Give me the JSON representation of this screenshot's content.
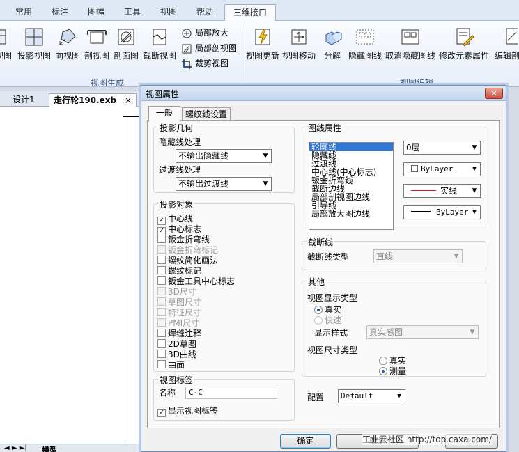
{
  "menu": {
    "tabs": [
      "常用",
      "标注",
      "图幅",
      "工具",
      "视图",
      "帮助",
      "三维接口"
    ],
    "active": "三维接口"
  },
  "ribbon": {
    "group1": {
      "buttons": [
        "视图",
        "投影视图",
        "向视图",
        "剖视图",
        "剖面图",
        "截断视图"
      ],
      "small": [
        "局部放大",
        "局部剖视图",
        "裁剪视图"
      ],
      "name": "视图生成"
    },
    "group2": {
      "buttons": [
        "视图更新",
        "视图移动",
        "分解",
        "隐藏图线",
        "取消隐藏图线",
        "修改元素属性",
        "编辑剖"
      ],
      "name": "视图编辑"
    }
  },
  "doc_tabs": [
    "设计1",
    "走行轮190.exb"
  ],
  "doc_tab_close": "×",
  "bottom_tab": "模型",
  "dialog": {
    "title": "视图属性",
    "close": "✕",
    "tabs": [
      "一般",
      "螺纹线设置"
    ],
    "projection": {
      "legend": "投影几何",
      "hidden_label": "隐藏线处理",
      "hidden_value": "不输出隐藏线",
      "transition_label": "过渡线处理",
      "transition_value": "不输出过渡线"
    },
    "objects": {
      "legend": "投影对象",
      "items": [
        {
          "label": "中心线",
          "checked": true,
          "enabled": true
        },
        {
          "label": "中心标志",
          "checked": true,
          "enabled": true
        },
        {
          "label": "钣金折弯线",
          "checked": false,
          "enabled": true
        },
        {
          "label": "钣金折弯标记",
          "checked": false,
          "enabled": false
        },
        {
          "label": "螺纹简化画法",
          "checked": false,
          "enabled": true
        },
        {
          "label": "螺纹标记",
          "checked": false,
          "enabled": true
        },
        {
          "label": "钣金工具中心标志",
          "checked": false,
          "enabled": true
        },
        {
          "label": "3D尺寸",
          "checked": false,
          "enabled": false
        },
        {
          "label": "草图尺寸",
          "checked": false,
          "enabled": false
        },
        {
          "label": "特征尺寸",
          "checked": false,
          "enabled": false
        },
        {
          "label": "PMI尺寸",
          "checked": false,
          "enabled": false
        },
        {
          "label": "焊缝注释",
          "checked": false,
          "enabled": true
        },
        {
          "label": "2D草图",
          "checked": false,
          "enabled": true
        },
        {
          "label": "3D曲线",
          "checked": false,
          "enabled": true
        },
        {
          "label": "曲面",
          "checked": false,
          "enabled": true
        }
      ]
    },
    "label_group": {
      "legend": "视图标签",
      "name_label": "名称",
      "name_value": "C-C",
      "show_label": "显示视图标签",
      "show_checked": true
    },
    "line_props": {
      "legend": "图线属性",
      "items": [
        "轮廓线",
        "隐藏线",
        "过渡线",
        "中心线(中心标志)",
        "钣金折弯线",
        "截断边线",
        "局部剖视图边线",
        "引导线",
        "局部放大图边线"
      ],
      "selected": "轮廓线",
      "layer": "0层",
      "color": "ByLayer",
      "linetype": "实线",
      "lineweight": "ByLayer",
      "line_color": "#d01414"
    },
    "break_line": {
      "legend": "截断线",
      "type_label": "截断线类型",
      "type_value": "直线"
    },
    "other": {
      "legend": "其他",
      "display_type_label": "视图显示类型",
      "display_real": "真实",
      "display_fast": "快速",
      "display_real_selected": true,
      "style_label": "显示样式",
      "style_value": "真实感图",
      "dim_type_label": "视图尺寸类型",
      "dim_real": "真实",
      "dim_measure": "测量",
      "dim_measure_selected": true
    },
    "config": {
      "label": "配置",
      "value": "Default"
    },
    "buttons": {
      "ok": "确定",
      "cancel": "取消",
      "help": "帮助"
    }
  },
  "watermark": "工业云社区 http://top.caxa.com/"
}
